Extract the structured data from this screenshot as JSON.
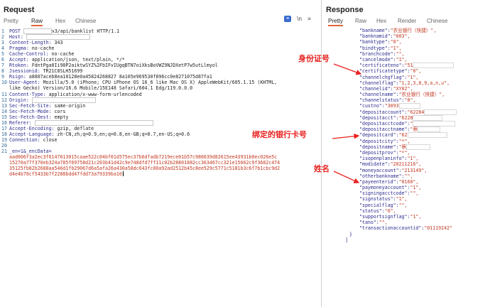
{
  "request": {
    "title": "Request",
    "tabs": [
      "Pretty",
      "Raw",
      "Hex",
      "Chinese"
    ],
    "active_tab": "Raw",
    "tool_newline": "\\n",
    "tool_menu": "≡",
    "lines": [
      {
        "n": "1",
        "k": "POST ",
        "v": "v3/api/banklist HTTP/1.1"
      },
      {
        "n": "2",
        "k": "Host: ",
        "v": ""
      },
      {
        "n": "3",
        "k": "Content-Length: ",
        "v": "343"
      },
      {
        "n": "4",
        "k": "Pragma: ",
        "v": "no-cache"
      },
      {
        "n": "5",
        "k": "Cache-Control: ",
        "v": "no-cache"
      },
      {
        "n": "6",
        "k": "Accept: ",
        "v": "application/json, text/plain, */*"
      },
      {
        "n": "7",
        "k": "Rtoken: ",
        "v": "FdntPga0Ii98P2aiktwSYZ%2FbIFvIUgqBTN7oiXksBoVWZ9NJDXetP7w5utLlmyol"
      },
      {
        "n": "8",
        "k": "Jsessionid: ",
        "v": "TR21C8SLH51699"
      },
      {
        "n": "9",
        "k": "Rsign: ",
        "v": "a8807aceb8ea10128e0a45824268827 8a105e969530f896cc0e8271075d87fa1"
      },
      {
        "n": "10",
        "k": "User-Agent: ",
        "v": "Mozilla/5.0 (iPhone; CPU iPhone OS 16_6 like Mac OS X) AppleWebKit/605.1.15 (KHTML,"
      },
      {
        "n": "",
        "k": "",
        "v": "like Gecko) Version/16.6 Mobile/15E148 Safari/604.1 Edg/119.0.0.0"
      },
      {
        "n": "11",
        "k": "Content-Type: ",
        "v": "application/x-www-form-urlencoded"
      },
      {
        "n": "12",
        "k": "Origin: ",
        "v": ""
      },
      {
        "n": "13",
        "k": "Sec-Fetch-Site: ",
        "v": "same-origin"
      },
      {
        "n": "14",
        "k": "Sec-Fetch-Mode: ",
        "v": "cors"
      },
      {
        "n": "15",
        "k": "Sec-Fetch-Dest: ",
        "v": "empty"
      },
      {
        "n": "16",
        "k": "Referer: ",
        "v": ""
      },
      {
        "n": "17",
        "k": "Accept-Encoding: ",
        "v": "gzip, deflate"
      },
      {
        "n": "18",
        "k": "Accept-Language: ",
        "v": "zh-CN,zh;q=0.9,en;q=0.8,en-GB;q=0.7,en-US;q=0.6"
      },
      {
        "n": "19",
        "k": "Connection: ",
        "v": "close"
      },
      {
        "n": "20",
        "k": "",
        "v": ""
      }
    ],
    "body_line_no": "21",
    "body_lines": [
      "_en=1&_encData=",
      "aad006f3a2ec3f6147613015caae522c04bf01d575ec37b6dfadb7219ece01b57c986639d82615ee43931b0ec026e5c",
      "15270a77f370eb324a785f69758d21c203b41d42c9e748dfd7ff11c02b28801882cc363467cc321e15662c9f3682c474",
      "35125fb82b2688aa546d1fb29067d6a5afa26a430a58dc643fc00a92ad2512b45c8ee529c5771c5181b3c6f7b1cbc9d2",
      "d4e4b70cf5433b7f2288bdd47fdd73a79339ba10"
    ]
  },
  "response": {
    "title": "Response",
    "tabs": [
      "Pretty",
      "Raw",
      "Hex",
      "Render",
      "Chinese"
    ],
    "active_tab": "Pretty",
    "lines": [
      {
        "k": "\"bankname\":",
        "v": "\"农业银行（快捷）\","
      },
      {
        "k": "\"banknamid\":",
        "v": "\"003\","
      },
      {
        "k": "\"banktype\":",
        "v": "\"0\","
      },
      {
        "k": "\"bindtype\":",
        "v": "\"1\","
      },
      {
        "k": "\"branchcode\":",
        "v": "\"\","
      },
      {
        "k": "\"cancelmode\":",
        "v": "\"1\","
      },
      {
        "k": "\"certificateno\":",
        "v": "\"51"
      },
      {
        "k": "\"certificatetype\":",
        "v": "\"0\","
      },
      {
        "k": "\"channelchgflag\":",
        "v": "\"1\","
      },
      {
        "k": "\"channelflag\":",
        "v": "\"1,2,3,8,9,a,n,u\","
      },
      {
        "k": "\"channelid\":",
        "v": "\"XY02\","
      },
      {
        "k": "\"channelname\":",
        "v": "\"农业银行（快捷）\","
      },
      {
        "k": "\"channelstatus\":",
        "v": "\"0\","
      },
      {
        "k": "\"custno\":",
        "v": "\"3093"
      },
      {
        "k": "\"depositaccount\":",
        "v": "\"62284"
      },
      {
        "k": "\"depositacct\":",
        "v": "\"6228"
      },
      {
        "k": "\"depositacctcode\":",
        "v": "\""
      },
      {
        "k": "\"depositacctname\":",
        "v": "\"蔡"
      },
      {
        "k": "\"depositcard\":",
        "v": "\"62"
      },
      {
        "k": "\"depositcity\":",
        "v": "\"*\","
      },
      {
        "k": "\"depositname\":",
        "v": "\"蔡"
      },
      {
        "k": "\"depositprov\":",
        "v": "\"*\","
      },
      {
        "k": "\"isopenplaninfo\":",
        "v": "\"1\","
      },
      {
        "k": "\"modidate\":",
        "v": "\"20211216\","
      },
      {
        "k": "\"moneyaccount\":",
        "v": "\"213149\","
      },
      {
        "k": "\"otherbankname\":",
        "v": "\"\","
      },
      {
        "k": "\"payeenterid\":",
        "v": "\"0160\","
      },
      {
        "k": "\"paymoneyaccount\":",
        "v": "\"1\","
      },
      {
        "k": "\"signingacctcode\":",
        "v": "\"\","
      },
      {
        "k": "\"signstatus\":",
        "v": "\"1\","
      },
      {
        "k": "\"specialflag\":",
        "v": "\"\","
      },
      {
        "k": "\"status\":",
        "v": "\"0\","
      },
      {
        "k": "\"supportsignflag\":",
        "v": "\"1\","
      },
      {
        "k": "\"tano\":",
        "v": "\"\","
      },
      {
        "k": "\"transactionaccountid\":",
        "v": "\"01119242\""
      },
      {
        "k": "}",
        "v": ""
      },
      {
        "k": "]",
        "v": ""
      }
    ]
  },
  "annotations": {
    "id_number": "身份证号",
    "bank_card": "绑定的银行卡号",
    "name": "姓名",
    "color": "#e8211f"
  }
}
